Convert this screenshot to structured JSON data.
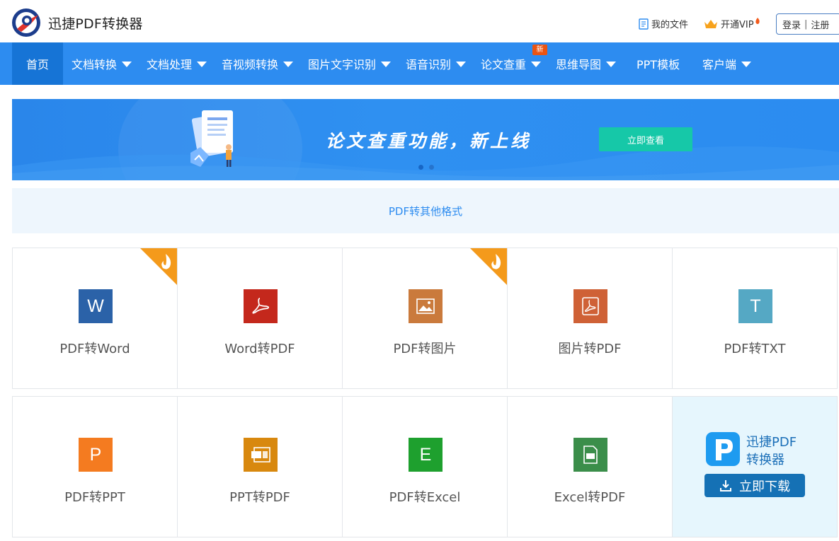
{
  "header": {
    "brand": "迅捷PDF转换器",
    "my_files": "我的文件",
    "vip": "开通VIP",
    "login": "登录",
    "separator": "|",
    "register": "注册"
  },
  "nav": {
    "items": [
      {
        "label": "首页",
        "dropdown": false,
        "active": true
      },
      {
        "label": "文档转换",
        "dropdown": true
      },
      {
        "label": "文档处理",
        "dropdown": true
      },
      {
        "label": "音视频转换",
        "dropdown": true
      },
      {
        "label": "图片文字识别",
        "dropdown": true
      },
      {
        "label": "语音识别",
        "dropdown": true
      },
      {
        "label": "论文查重",
        "dropdown": true,
        "badge": "新"
      },
      {
        "label": "思维导图",
        "dropdown": true
      },
      {
        "label": "PPT模板",
        "dropdown": false
      },
      {
        "label": "客户端",
        "dropdown": true
      }
    ]
  },
  "banner": {
    "title": "论文查重功能，新上线",
    "button": "立即查看"
  },
  "section": {
    "title": "PDF转其他格式"
  },
  "tools_row1": [
    {
      "label": "PDF转Word",
      "icon": "word-icon",
      "glyph": "W",
      "color": "#2b62a8",
      "hot": true
    },
    {
      "label": "Word转PDF",
      "icon": "pdf-acrobat-icon",
      "glyph": "",
      "color": "#c4281c",
      "hot": false
    },
    {
      "label": "PDF转图片",
      "icon": "image-icon",
      "glyph": "",
      "color": "#ca7a3c",
      "hot": true
    },
    {
      "label": "图片转PDF",
      "icon": "pdf-file-icon",
      "glyph": "",
      "color": "#cf6136",
      "hot": false
    },
    {
      "label": "PDF转TXT",
      "icon": "txt-icon",
      "glyph": "T",
      "color": "#55a8c4",
      "hot": false
    }
  ],
  "tools_row2": [
    {
      "label": "PDF转PPT",
      "icon": "ppt-icon",
      "glyph": "P",
      "color": "#f47b20"
    },
    {
      "label": "PPT转PDF",
      "icon": "ppt-pdf-icon",
      "glyph": "",
      "color": "#d8880e"
    },
    {
      "label": "PDF转Excel",
      "icon": "excel-icon",
      "glyph": "E",
      "color": "#1ea02e"
    },
    {
      "label": "Excel转PDF",
      "icon": "excel-pdf-icon",
      "glyph": "",
      "color": "#3b8e4a"
    }
  ],
  "download": {
    "name_line1": "迅捷PDF",
    "name_line2": "转换器",
    "button": "立即下载"
  },
  "colors": {
    "nav_bg": "#2d8cf0",
    "nav_active": "#1674d6",
    "accent_teal": "#16c8a8",
    "download_btn": "#1571b5"
  }
}
